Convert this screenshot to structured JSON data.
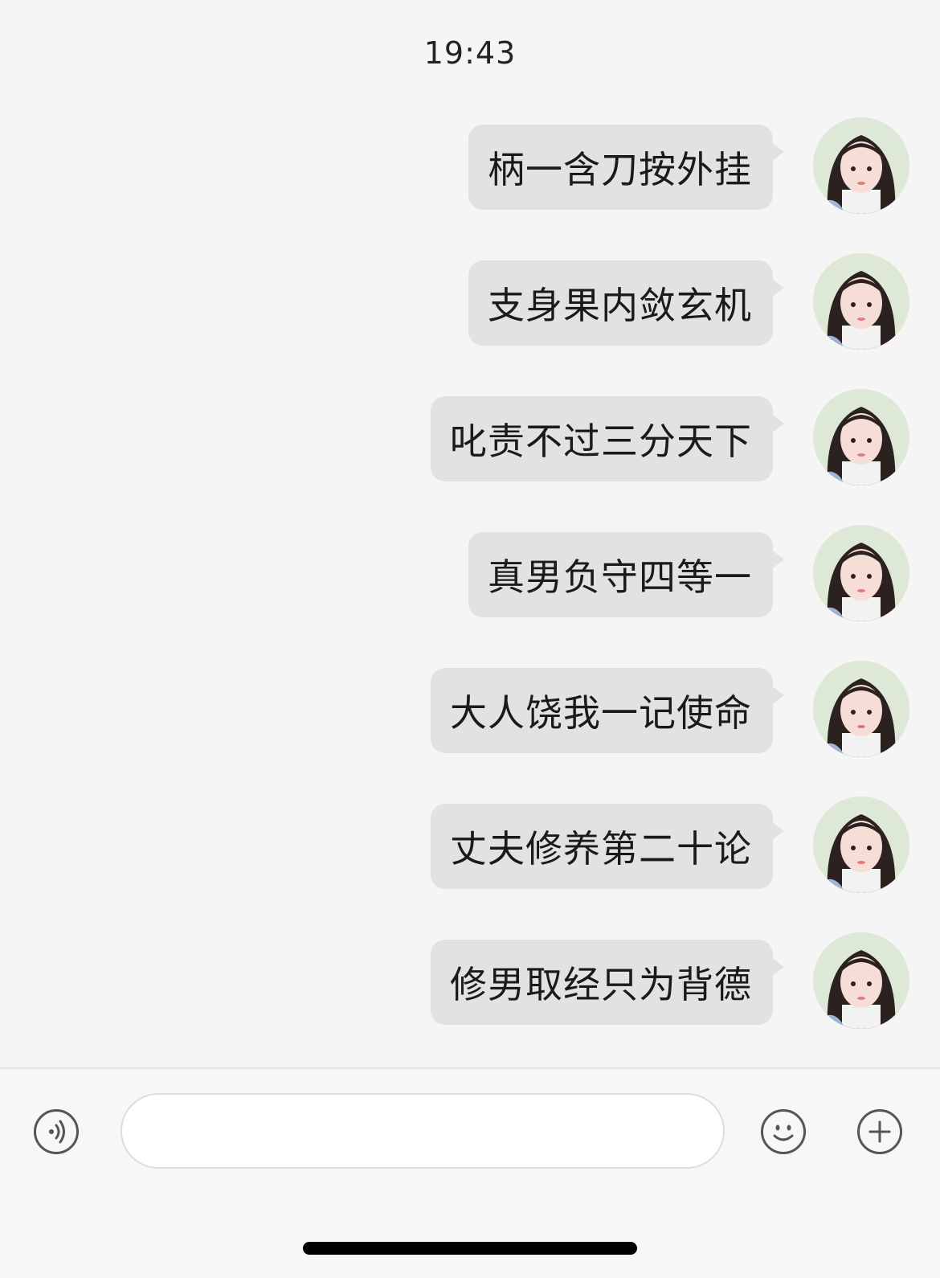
{
  "chat": {
    "timestamp": "19:43",
    "messages": [
      {
        "text": "柄一含刀按外挂"
      },
      {
        "text": "支身果内敛玄机"
      },
      {
        "text": "叱责不过三分天下"
      },
      {
        "text": "真男负守四等一"
      },
      {
        "text": "大人饶我一记使命"
      },
      {
        "text": "丈夫修养第二十论"
      },
      {
        "text": "修男取经只为背德"
      }
    ]
  },
  "input_bar": {
    "voice_icon": "voice-icon",
    "emoji_icon": "smiley-icon",
    "plus_icon": "plus-icon",
    "placeholder": ""
  },
  "colors": {
    "background": "#f5f5f5",
    "bubble": "#e2e2e2",
    "text": "#1a1a1a",
    "icon": "#555555"
  }
}
